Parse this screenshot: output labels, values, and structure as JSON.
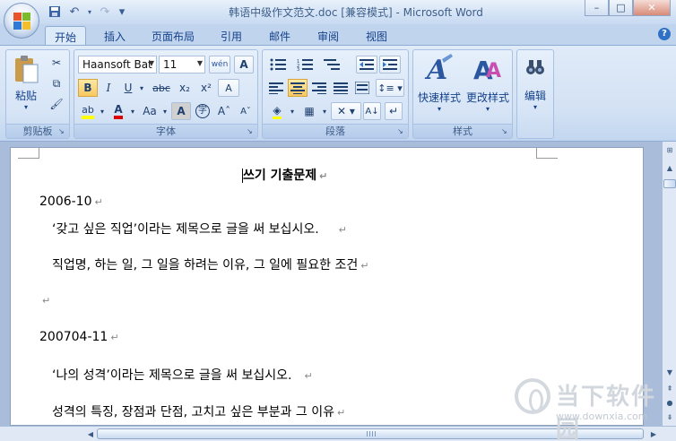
{
  "window": {
    "title": "韩语中级作文范文.doc [兼容模式] - Microsoft Word",
    "minimize": "–",
    "maximize": "□",
    "close": "✕"
  },
  "qat": {
    "save": "save-icon",
    "undo": "↶",
    "redo": "↷",
    "customize": "▾"
  },
  "tabs": [
    {
      "label": "开始"
    },
    {
      "label": "插入"
    },
    {
      "label": "页面布局"
    },
    {
      "label": "引用"
    },
    {
      "label": "邮件"
    },
    {
      "label": "审阅"
    },
    {
      "label": "视图"
    }
  ],
  "ribbon": {
    "clipboard": {
      "label": "剪贴板",
      "paste": "粘贴"
    },
    "font": {
      "label": "字体",
      "font_name": "Haansoft Bat",
      "font_size": "11",
      "bold": "B",
      "italic": "I",
      "underline": "U",
      "strike": "abc",
      "subscript": "x₂",
      "superscript": "x²",
      "change_case": "Aa",
      "char_border": "A",
      "grow": "Aˆ",
      "shrink": "Aˇ",
      "phonetic": "wén",
      "clear": "A"
    },
    "paragraph": {
      "label": "段落"
    },
    "styles": {
      "label": "样式",
      "quick_styles": "快速样式",
      "change_styles": "更改样式"
    },
    "editing": {
      "label": "编辑"
    }
  },
  "document": {
    "lines": [
      {
        "text": "쓰기 기출문제",
        "pm": "↵"
      },
      {
        "text": "2006-10",
        "pm": "↵"
      },
      {
        "text": "‘갖고 싶은 직업’이라는 제목으로 글을 써 보십시오.",
        "pm": "↵"
      },
      {
        "text": "직업명, 하는 일, 그 일을 하려는 이유, 그 일에 필요한 조건",
        "pm": "↵"
      },
      {
        "text": "",
        "pm": "↵"
      },
      {
        "text": "200704-11",
        "pm": "↵"
      },
      {
        "text": "‘나의 성격’이라는 제목으로 글을 써 보십시오.",
        "pm": "↵"
      },
      {
        "text": "성격의 특징, 장점과 단점, 고치고 싶은 부분과 그 이유",
        "pm": "↵"
      }
    ]
  },
  "watermark": {
    "text": "当下软件园",
    "url": "www.downxia.com"
  }
}
